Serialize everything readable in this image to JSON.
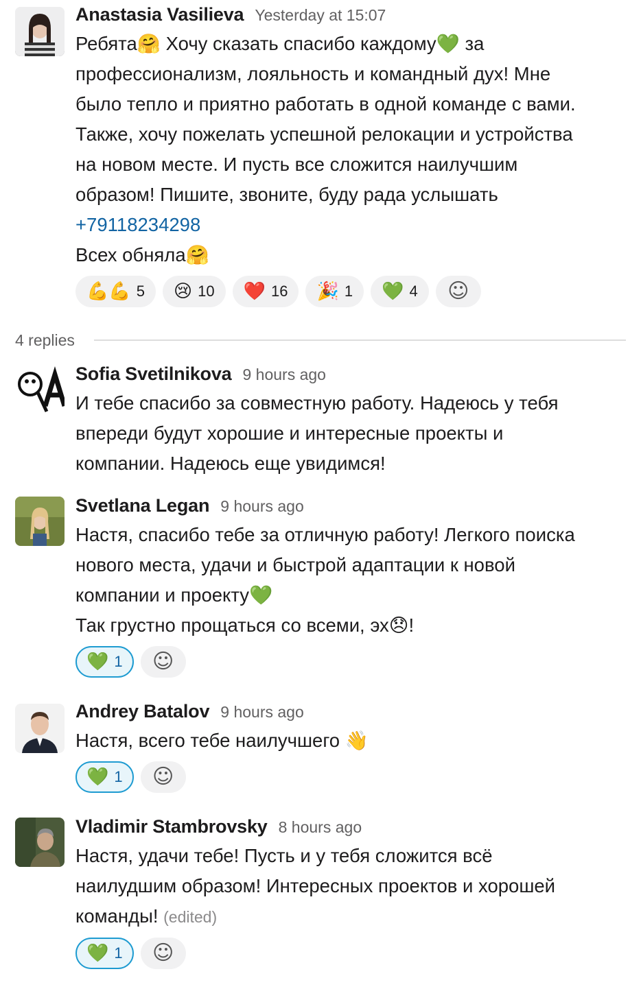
{
  "thread": {
    "replies_label": "4 replies"
  },
  "messages": [
    {
      "author": "Anastasia Vasilieva",
      "time": "Yesterday at 15:07",
      "lines": [
        "Ребята🤗  Хочу сказать спасибо каждому💚 за",
        "профессионализм, лояльность и командный дух! Мне",
        "было тепло и приятно работать в одной команде с вами.",
        "Также, хочу пожелать успешной релокации и устройства",
        "на новом месте. И пусть все сложится наилучшим",
        "образом! Пишите, звоните, буду рада услышать"
      ],
      "phone": "+79118234298",
      "closing": "Всех обняла🤗",
      "reactions": [
        {
          "emoji": "💪💪",
          "count": "5"
        },
        {
          "emoji": "😢",
          "count": "10"
        },
        {
          "emoji": "❤️",
          "count": "16"
        },
        {
          "emoji": "🎉",
          "count": "1"
        },
        {
          "emoji": "💚",
          "count": "4"
        }
      ]
    },
    {
      "author": "Sofia Svetilnikova",
      "time": "9 hours ago",
      "lines": [
        "И тебе спасибо за совместную работу. Надеюсь у тебя",
        "впереди будут хорошие и интересные проекты и",
        "компании. Надеюсь еще увидимся!"
      ]
    },
    {
      "author": "Svetlana Legan",
      "time": "9 hours ago",
      "lines": [
        "Настя, спасибо тебе за отличную работу! Легкого поиска",
        "нового места, удачи и быстрой адаптации к новой",
        "компании и проекту💚",
        "Так грустно прощаться со всеми, эх😞!"
      ],
      "reactions": [
        {
          "emoji": "💚",
          "count": "1"
        }
      ]
    },
    {
      "author": "Andrey Batalov",
      "time": "9 hours ago",
      "lines": [
        "Настя, всего тебе наилучшего 👋"
      ],
      "reactions": [
        {
          "emoji": "💚",
          "count": "1"
        }
      ]
    },
    {
      "author": "Vladimir Stambrovsky",
      "time": "8 hours ago",
      "lines": [
        "Настя, удачи тебе! Пусть и у тебя сложится всё",
        "наилудшим образом! Интересных проектов и хорошей",
        "команды!"
      ],
      "edited": "(edited)",
      "reactions": [
        {
          "emoji": "💚",
          "count": "1"
        }
      ]
    }
  ],
  "icons": {
    "add_reaction": "☺",
    "avatar_placeholder": "QA"
  },
  "colors": {
    "link": "#1264a3",
    "reaction_selected_border": "#1d9bd1",
    "reaction_selected_bg": "#e8f5fa",
    "reaction_bg": "#f1f1f2"
  }
}
